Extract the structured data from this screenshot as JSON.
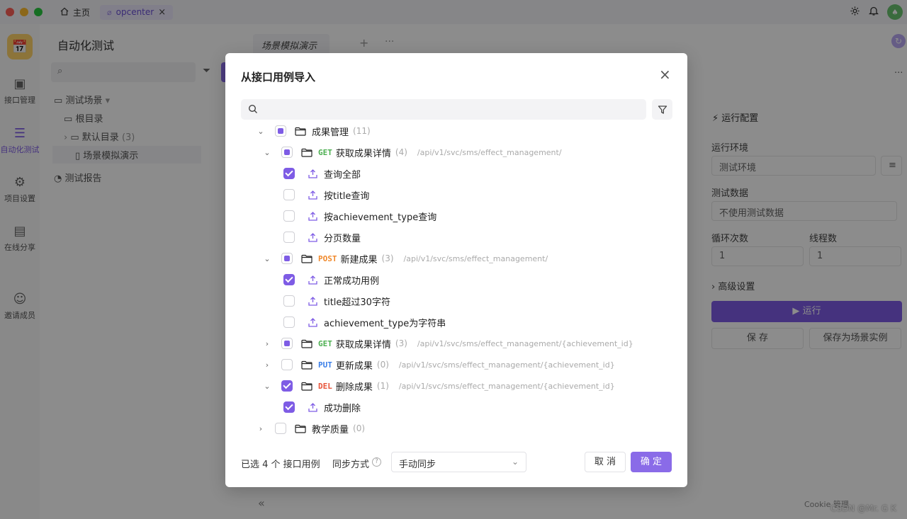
{
  "titlebar": {
    "home_tab": "主页",
    "project_tab": "opcenter",
    "close_glyph": "×"
  },
  "left_nav": {
    "items": [
      {
        "label": "接口管理",
        "icon": "api-icon"
      },
      {
        "label": "自动化测试",
        "icon": "automation-icon",
        "active": true
      },
      {
        "label": "项目设置",
        "icon": "settings-icon"
      },
      {
        "label": "在线分享",
        "icon": "share-icon"
      },
      {
        "label": "邀请成员",
        "icon": "invite-icon"
      }
    ]
  },
  "sidebar": {
    "title": "自动化测试",
    "tree": {
      "scenes": "测试场景",
      "root": "根目录",
      "default_dir": "默认目录",
      "default_dir_count": "(3)",
      "scene_item": "场景模拟演示",
      "reports": "测试报告"
    }
  },
  "workspace": {
    "tab": "场景模拟演示",
    "plus": "+",
    "more": "···"
  },
  "run_panel": {
    "title": "运行配置",
    "env_label": "运行环境",
    "env_value": "测试环境",
    "data_label": "测试数据",
    "data_value": "不使用测试数据",
    "loop_label": "循环次数",
    "loop_value": "1",
    "thread_label": "线程数",
    "thread_value": "1",
    "advanced": "高级设置",
    "run": "运行",
    "save": "保 存",
    "save_as": "保存为场景实例"
  },
  "bottom": {
    "collapse": "«",
    "cookie": "Cookie 管理",
    "watermark": "CSDN @Mr. G K"
  },
  "modal": {
    "title": "从接口用例导入",
    "close": "×",
    "search_placeholder": "",
    "rows": [
      {
        "type": "folder",
        "indent": 0,
        "expanded": true,
        "state": "half",
        "name": "成果管理",
        "count": "(11)"
      },
      {
        "type": "api",
        "indent": 1,
        "expanded": true,
        "state": "half",
        "method": "GET",
        "name": "获取成果详情",
        "count": "(4)",
        "path": "/api/v1/svc/sms/effect_management/"
      },
      {
        "type": "case",
        "indent": 2,
        "state": "checked",
        "name": "查询全部"
      },
      {
        "type": "case",
        "indent": 2,
        "state": "none",
        "name": "按title查询"
      },
      {
        "type": "case",
        "indent": 2,
        "state": "none",
        "name": "按achievement_type查询"
      },
      {
        "type": "case",
        "indent": 2,
        "state": "none",
        "name": "分页数量"
      },
      {
        "type": "api",
        "indent": 1,
        "expanded": true,
        "state": "half",
        "method": "POST",
        "name": "新建成果",
        "count": "(3)",
        "path": "/api/v1/svc/sms/effect_management/"
      },
      {
        "type": "case",
        "indent": 2,
        "state": "checked",
        "name": "正常成功用例"
      },
      {
        "type": "case",
        "indent": 2,
        "state": "none",
        "name": "title超过30字符"
      },
      {
        "type": "case",
        "indent": 2,
        "state": "none",
        "name": "achievement_type为字符串"
      },
      {
        "type": "api",
        "indent": 1,
        "expanded": false,
        "state": "half",
        "method": "GET",
        "name": "获取成果详情",
        "count": "(3)",
        "path": "/api/v1/svc/sms/effect_management/{achievement_id}"
      },
      {
        "type": "api",
        "indent": 1,
        "expanded": false,
        "state": "none",
        "method": "PUT",
        "name": "更新成果",
        "count": "(0)",
        "path": "/api/v1/svc/sms/effect_management/{achievement_id}"
      },
      {
        "type": "api",
        "indent": 1,
        "expanded": true,
        "state": "checked",
        "method": "DEL",
        "name": "删除成果",
        "count": "(1)",
        "path": "/api/v1/svc/sms/effect_management/{achievement_id}"
      },
      {
        "type": "case",
        "indent": 2,
        "state": "checked",
        "name": "成功删除"
      },
      {
        "type": "folder",
        "indent": 0,
        "expanded": false,
        "state": "none",
        "name": "教学质量",
        "count": "(0)"
      }
    ],
    "footer": {
      "selected_text": "已选 4 个 接口用例",
      "sync_label": "同步方式",
      "sync_value": "手动同步",
      "cancel": "取 消",
      "confirm": "确 定"
    }
  },
  "colors": {
    "accent": "#7e5ce5",
    "GET": "#4caf50",
    "POST": "#f0892c",
    "PUT": "#3a7ee8",
    "DEL": "#e8543a"
  }
}
